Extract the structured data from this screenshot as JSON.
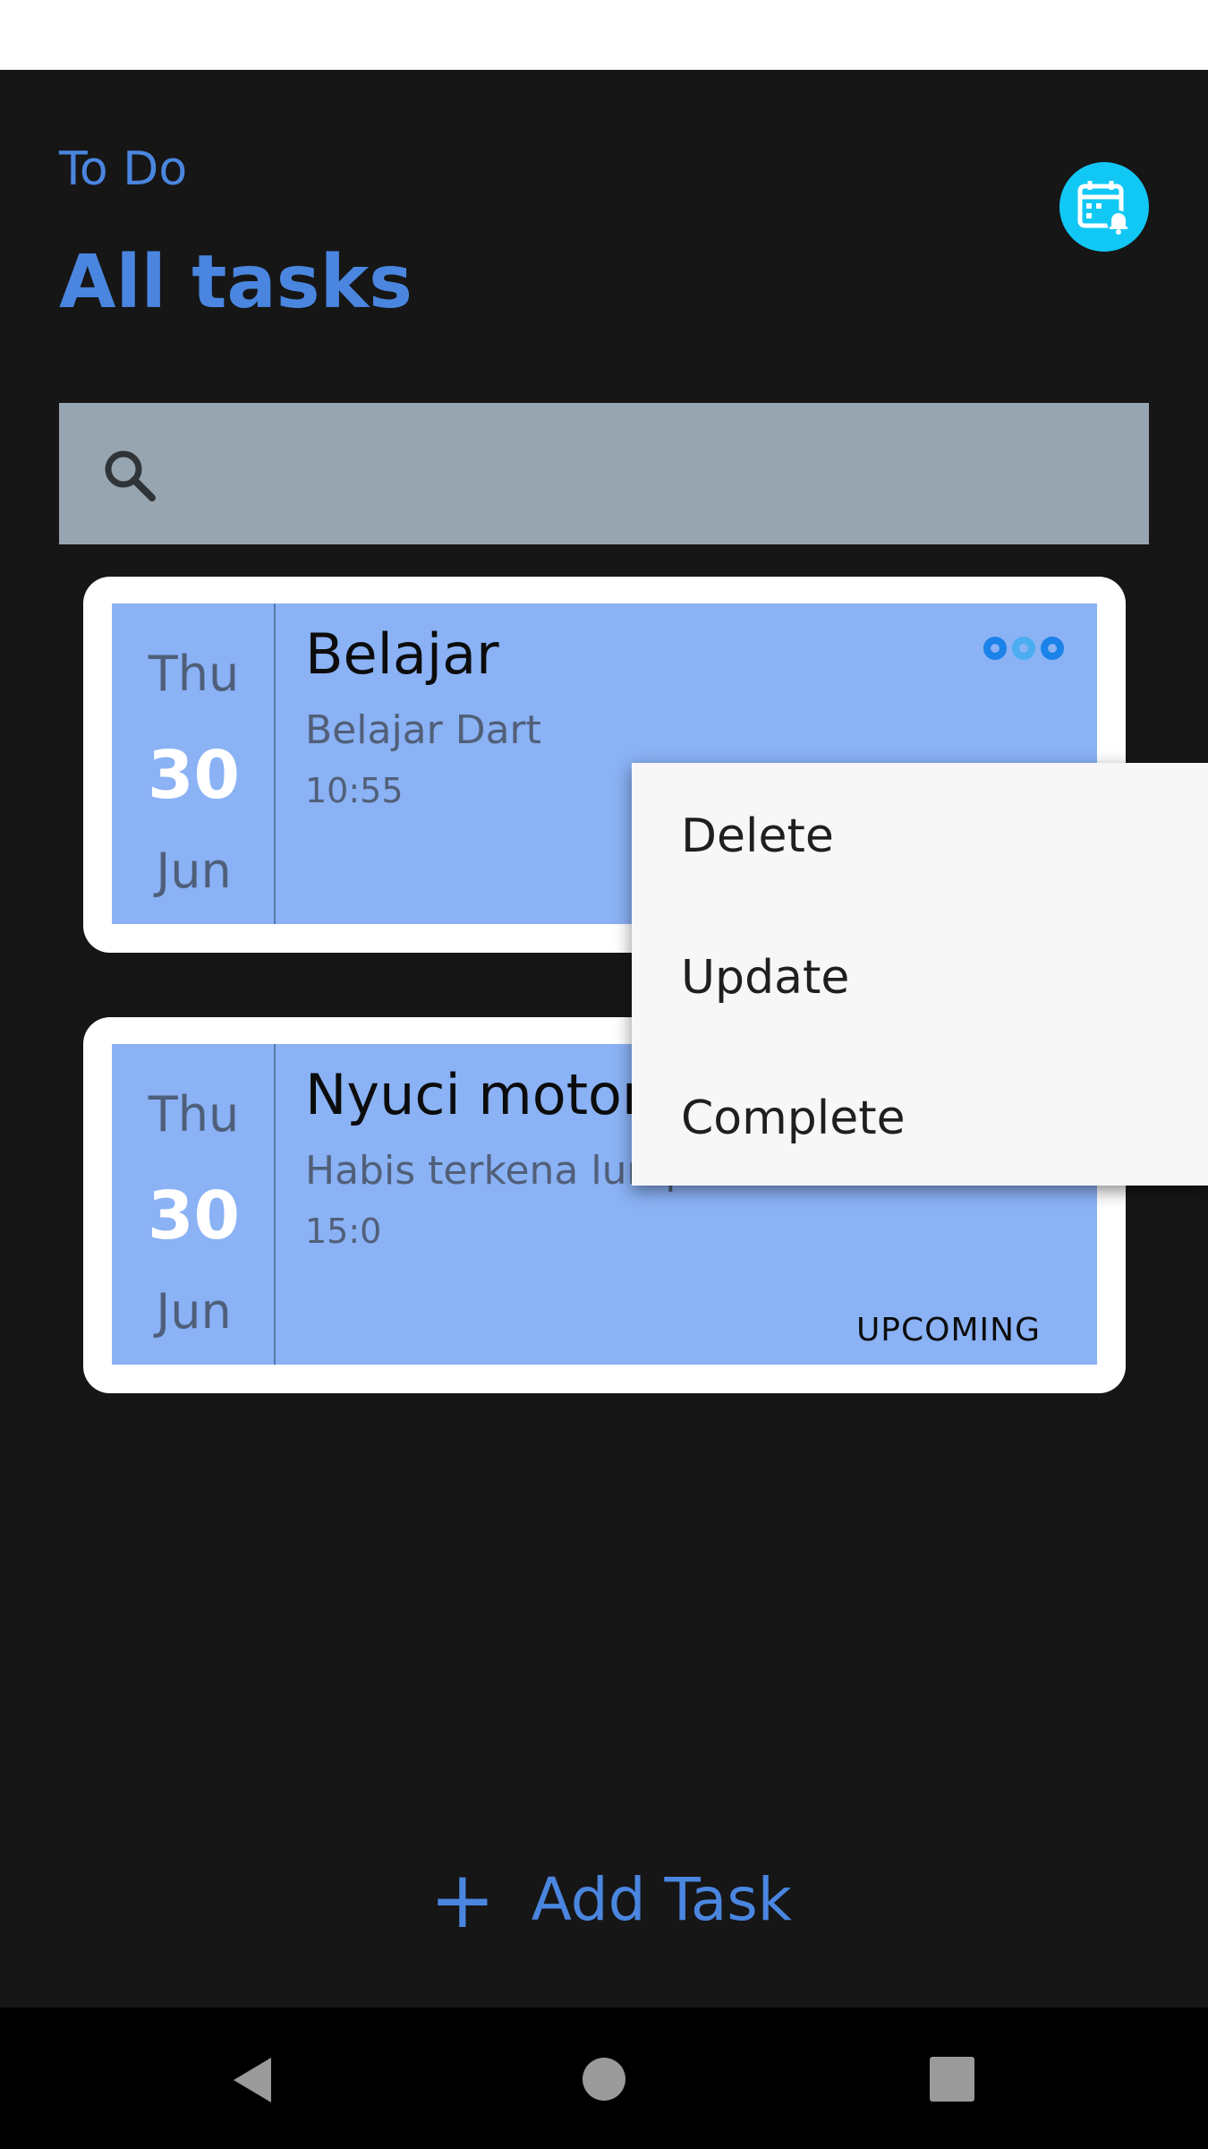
{
  "header": {
    "app_name": "To Do",
    "title": "All tasks",
    "calendar_button_icon": "calendar-bell-icon"
  },
  "search": {
    "icon": "search-icon",
    "value": "",
    "placeholder": ""
  },
  "tasks": [
    {
      "weekday": "Thu",
      "day": "30",
      "month": "Jun",
      "title": "Belajar",
      "description": "Belajar Dart",
      "time": "10:55",
      "status": ""
    },
    {
      "weekday": "Thu",
      "day": "30",
      "month": "Jun",
      "title": "Nyuci motor",
      "description": "Habis terkena lumpur",
      "time": "15:0",
      "status": "UPCOMING"
    }
  ],
  "popup_menu": {
    "items": [
      "Delete",
      "Update",
      "Complete"
    ]
  },
  "footer": {
    "add_task_label": "Add Task",
    "add_task_icon": "+"
  },
  "colors": {
    "background": "#161616",
    "accent": "#4a86e0",
    "card_fill": "#8ab2f5",
    "calendar_button": "#11c8f5",
    "search_bar": "#97a5b0"
  }
}
